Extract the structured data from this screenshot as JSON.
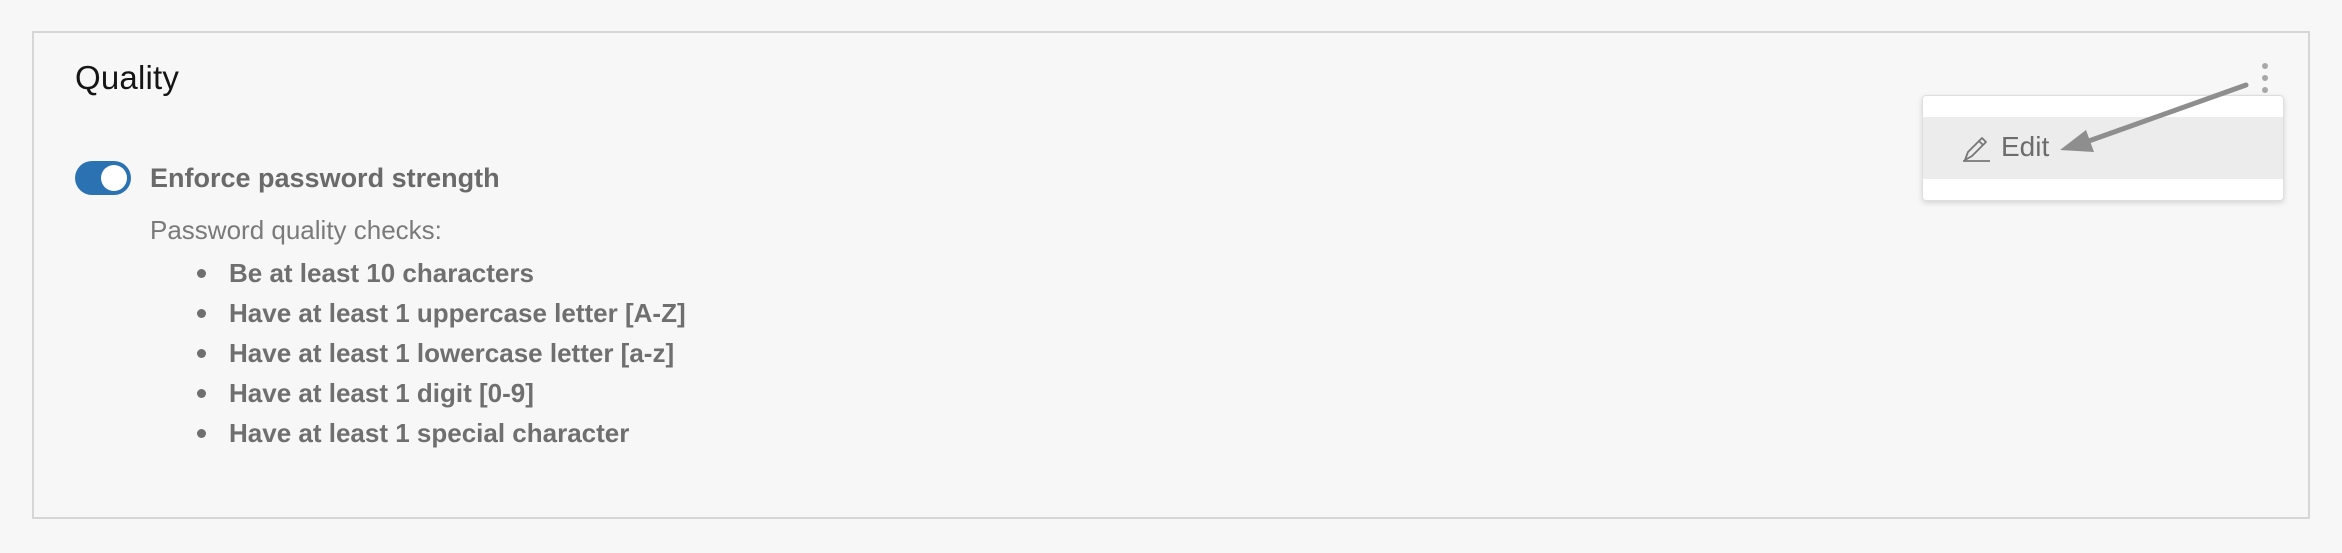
{
  "section": {
    "title": "Quality"
  },
  "toggle": {
    "label": "Enforce password strength",
    "state": "on",
    "color": "#2b72b3"
  },
  "checks": {
    "heading": "Password quality checks:",
    "items": [
      "Be at least 10 characters",
      "Have at least 1 uppercase letter [A-Z]",
      "Have at least 1 lowercase letter [a-z]",
      "Have at least 1 digit [0-9]",
      "Have at least 1 special character"
    ]
  },
  "menu": {
    "kebab_icon": "kebab-vertical-icon",
    "items": [
      {
        "label": "Edit",
        "icon": "pencil-icon"
      }
    ]
  },
  "annotation": {
    "icon": "arrow-icon",
    "color": "#8e8e8e"
  }
}
